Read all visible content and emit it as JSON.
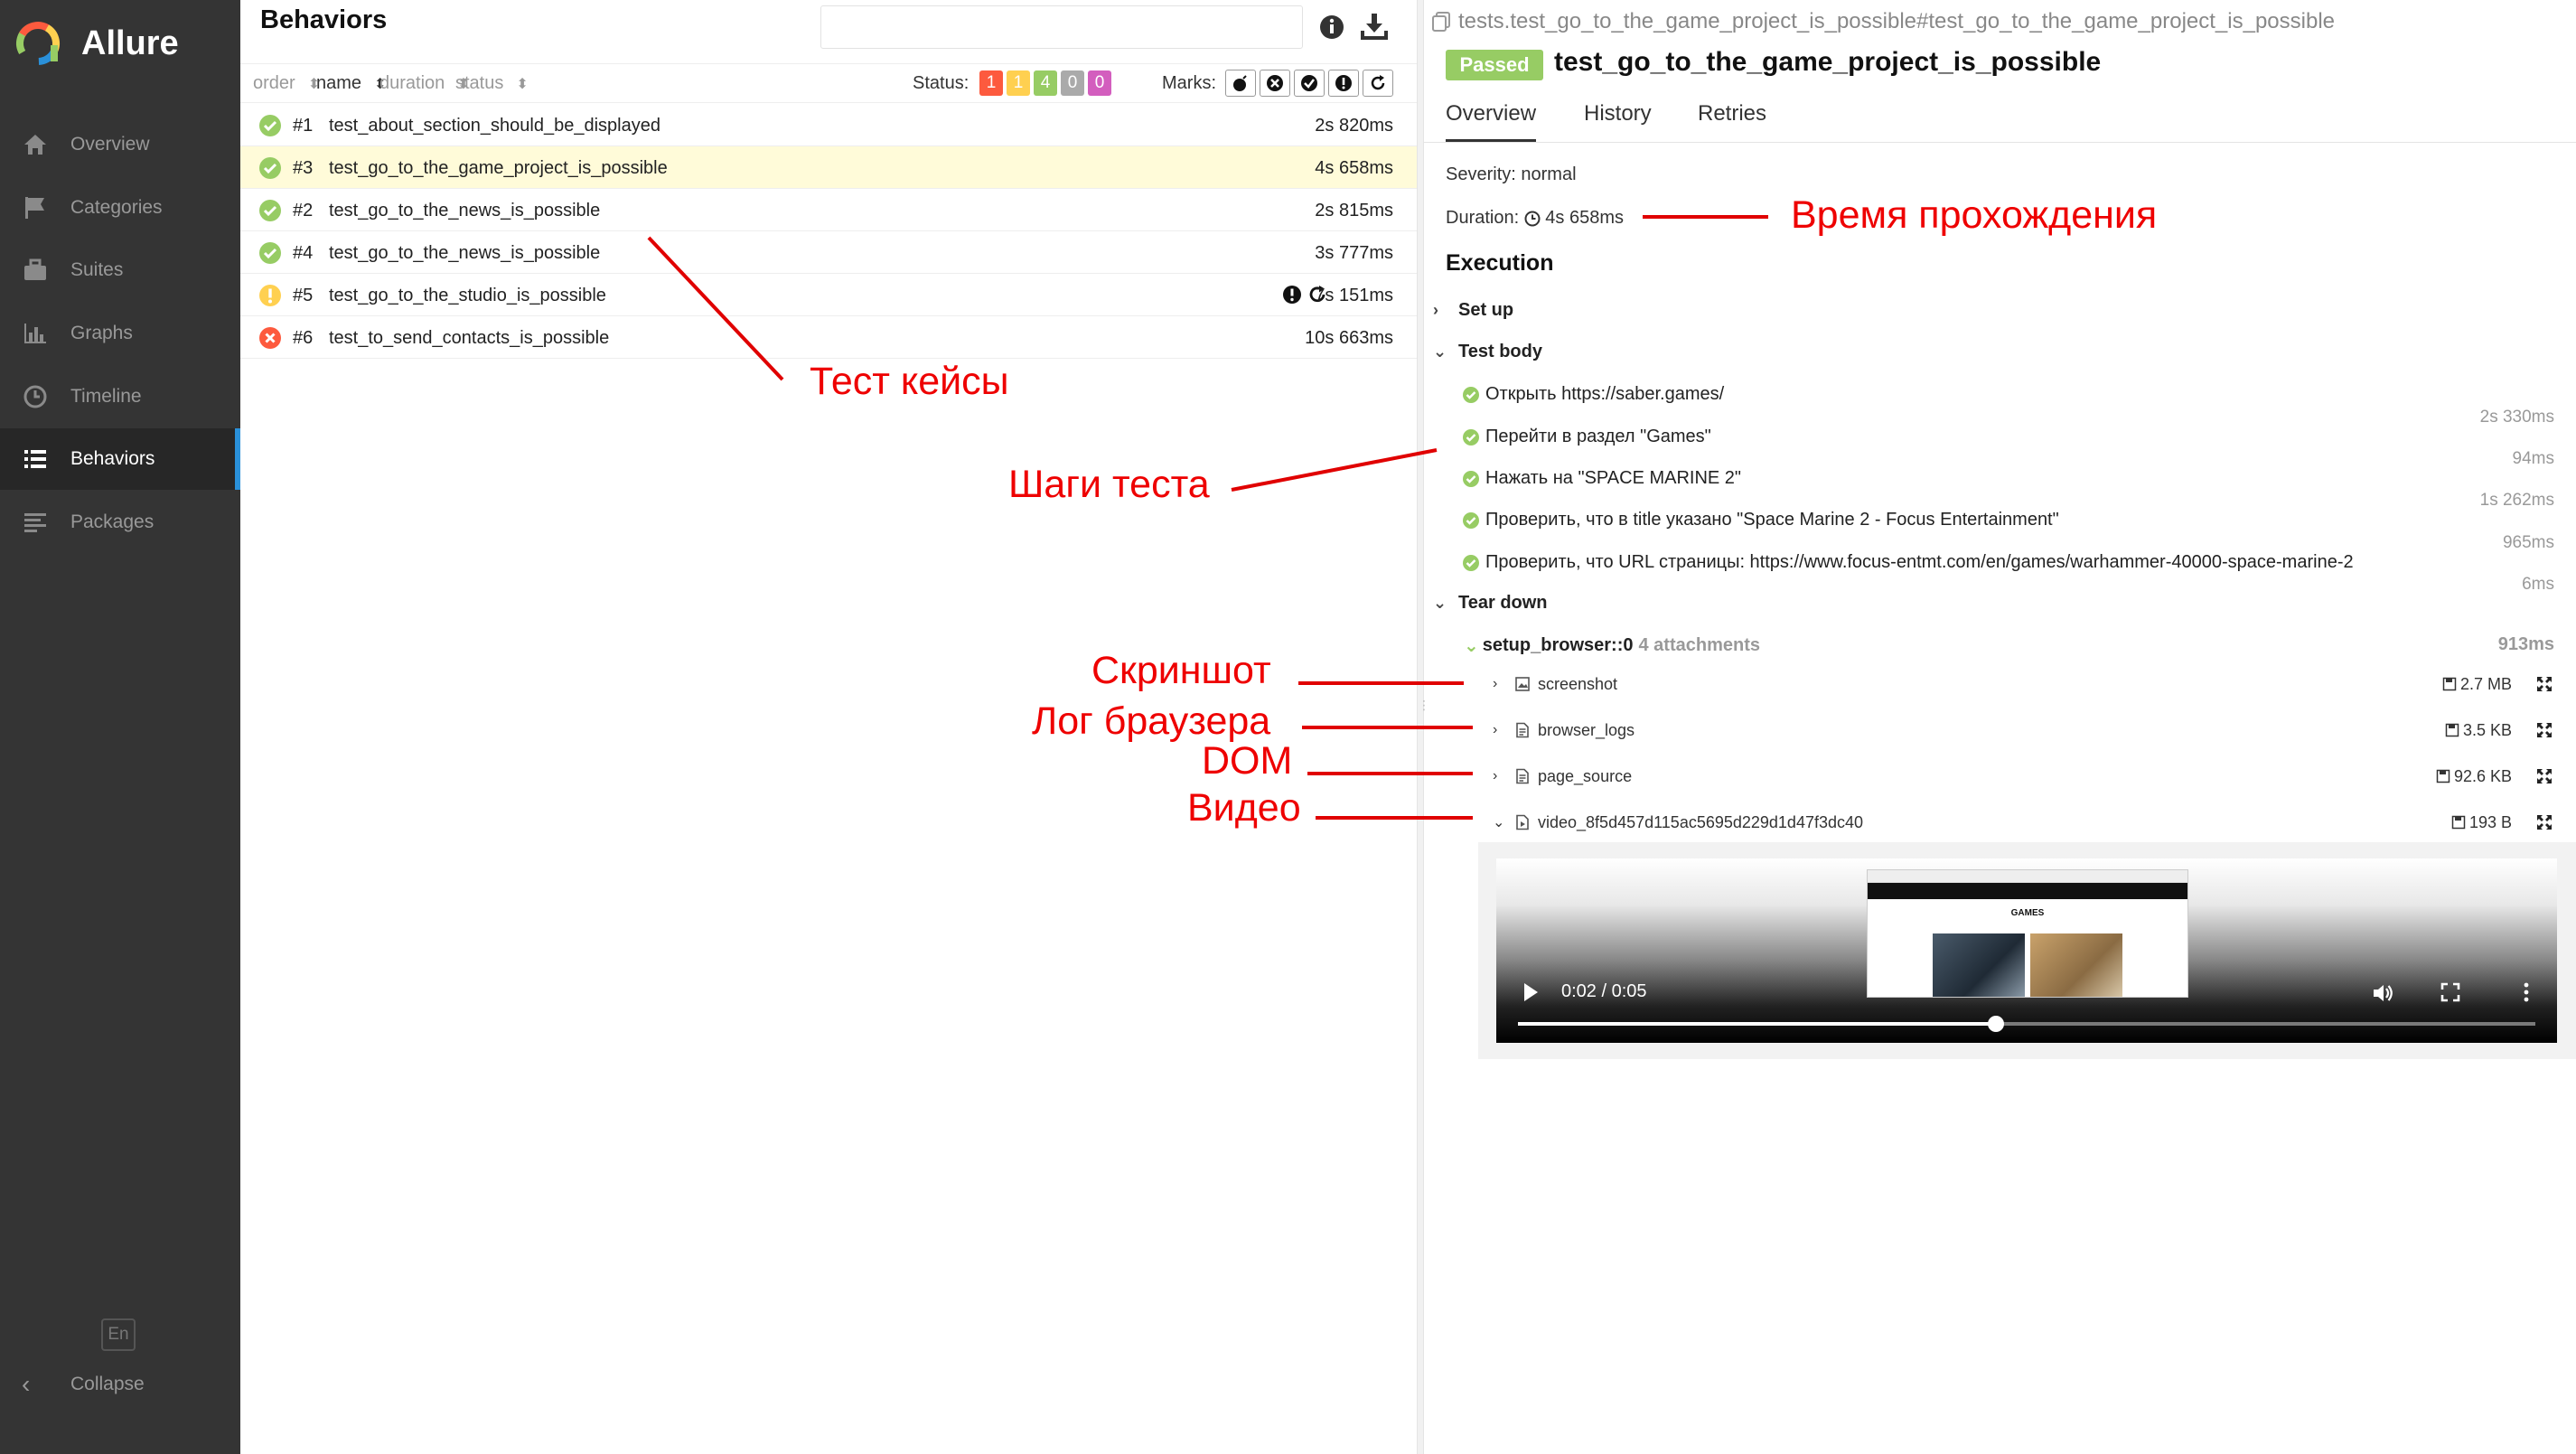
{
  "sidebar": {
    "brand": "Allure",
    "items": [
      {
        "label": "Overview",
        "icon": "home-icon",
        "active": false
      },
      {
        "label": "Categories",
        "icon": "flag-icon",
        "active": false
      },
      {
        "label": "Suites",
        "icon": "briefcase-icon",
        "active": false
      },
      {
        "label": "Graphs",
        "icon": "bar-chart-icon",
        "active": false
      },
      {
        "label": "Timeline",
        "icon": "clock-icon",
        "active": false
      },
      {
        "label": "Behaviors",
        "icon": "list-icon",
        "active": true
      },
      {
        "label": "Packages",
        "icon": "packages-icon",
        "active": false
      }
    ],
    "language": "En",
    "collapse_label": "Collapse"
  },
  "behaviors": {
    "title": "Behaviors",
    "filter_placeholder": "",
    "columns": {
      "order": "order",
      "name": "name",
      "duration": "duration",
      "status": "status"
    },
    "status_label": "Status:",
    "status_counts": [
      {
        "value": "1",
        "color": "#fd5a3e"
      },
      {
        "value": "1",
        "color": "#ffd050"
      },
      {
        "value": "4",
        "color": "#97cc64"
      },
      {
        "value": "0",
        "color": "#aaaaaa"
      },
      {
        "value": "0",
        "color": "#d35ebe"
      }
    ],
    "marks_label": "Marks:",
    "marks": [
      "bomb-icon",
      "close-circle-icon",
      "check-circle-icon",
      "exclamation-circle-icon",
      "refresh-icon"
    ],
    "tests": [
      {
        "num": "#1",
        "name": "test_about_section_should_be_displayed",
        "duration": "2s 820ms",
        "status": "passed",
        "selected": false,
        "flaky": false
      },
      {
        "num": "#3",
        "name": "test_go_to_the_game_project_is_possible",
        "duration": "4s 658ms",
        "status": "passed",
        "selected": true,
        "flaky": false
      },
      {
        "num": "#2",
        "name": "test_go_to_the_news_is_possible",
        "duration": "2s 815ms",
        "status": "passed",
        "selected": false,
        "flaky": false
      },
      {
        "num": "#4",
        "name": "test_go_to_the_news_is_possible",
        "duration": "3s 777ms",
        "status": "passed",
        "selected": false,
        "flaky": false
      },
      {
        "num": "#5",
        "name": "test_go_to_the_studio_is_possible",
        "duration": "7s 151ms",
        "status": "broken",
        "selected": false,
        "flaky": true
      },
      {
        "num": "#6",
        "name": "test_to_send_contacts_is_possible",
        "duration": "10s 663ms",
        "status": "failed",
        "selected": false,
        "flaky": false
      }
    ]
  },
  "detail": {
    "fullname": "tests.test_go_to_the_game_project_is_possible#test_go_to_the_game_project_is_possible",
    "status_badge": "Passed",
    "title": "test_go_to_the_game_project_is_possible",
    "tabs": [
      "Overview",
      "History",
      "Retries"
    ],
    "severity_label": "Severity:",
    "severity_value": "normal",
    "duration_label": "Duration:",
    "duration_value": "4s 658ms",
    "execution_title": "Execution",
    "setup_label": "Set up",
    "test_body_label": "Test body",
    "steps": [
      {
        "text": "Открыть https://saber.games/",
        "duration": "2s 330ms"
      },
      {
        "text": "Перейти в раздел \"Games\"",
        "duration": "94ms"
      },
      {
        "text": "Нажать на \"SPACE MARINE 2\"",
        "duration": "1s 262ms"
      },
      {
        "text": "Проверить, что в title указано \"Space Marine 2 - Focus Entertainment\"",
        "duration": "965ms"
      },
      {
        "text": "Проверить, что URL страницы: https://www.focus-entmt.com/en/games/warhammer-40000-space-marine-2",
        "duration": "6ms"
      }
    ],
    "teardown_label": "Tear down",
    "teardown_fixture": {
      "name": "setup_browser::0",
      "attachments_label": "4 attachments",
      "duration": "913ms"
    },
    "attachments": [
      {
        "name": "screenshot",
        "size": "2.7 MB",
        "expanded": false,
        "icon": "image-file-icon"
      },
      {
        "name": "browser_logs",
        "size": "3.5 KB",
        "expanded": false,
        "icon": "text-file-icon"
      },
      {
        "name": "page_source",
        "size": "92.6 KB",
        "expanded": false,
        "icon": "text-file-icon"
      },
      {
        "name": "video_8f5d457d115ac5695d229d1d47f3dc40",
        "size": "193 B",
        "expanded": true,
        "icon": "video-file-icon"
      }
    ],
    "video": {
      "time": "0:02 / 0:05",
      "progress": 0.47,
      "frame_heading": "GAMES"
    }
  },
  "annotations": {
    "test_cases": "Тест кейсы",
    "test_steps": "Шаги теста",
    "pass_time": "Время прохождения",
    "screenshot": "Скриншот",
    "browser_log": "Лог браузера",
    "dom": "DOM",
    "video": "Видео",
    "color": "#e00000"
  }
}
